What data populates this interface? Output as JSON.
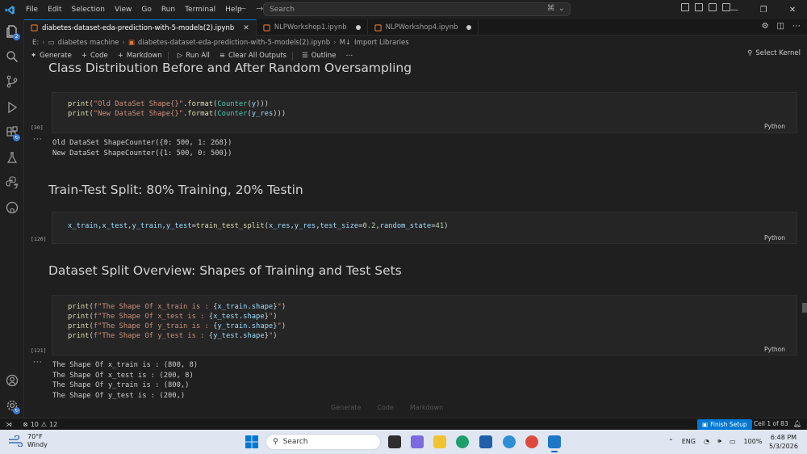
{
  "window": {
    "menu": [
      "File",
      "Edit",
      "Selection",
      "View",
      "Go",
      "Run",
      "Terminal",
      "Help"
    ],
    "search_placeholder": "Search"
  },
  "tabs": [
    {
      "label": "diabetes-dataset-eda-prediction-with-5-models(2).ipynb",
      "active": true,
      "modified": false
    },
    {
      "label": "NLPWorkshop1.ipynb",
      "active": false,
      "modified": true
    },
    {
      "label": "NLPWorkshop4.ipynb",
      "active": false,
      "modified": true
    }
  ],
  "breadcrumb": {
    "root": "E:",
    "folder": "diabetes machine",
    "file": "diabetes-dataset-eda-prediction-with-5-models(2).ipynb",
    "section_prefix": "M↓",
    "section": "Import Libraries"
  },
  "toolbar": {
    "generate": "Generate",
    "code": "Code",
    "markdown": "Markdown",
    "run_all": "Run All",
    "clear_outputs": "Clear All Outputs",
    "outline": "Outline",
    "select_kernel": "Select Kernel"
  },
  "headings": {
    "h1": "Class Distribution Before and After Random Oversampling",
    "h2": "Train-Test Split: 80% Training, 20% Testin",
    "h3": "Dataset Split Overview: Shapes of Training and Test Sets"
  },
  "cells": {
    "c1": {
      "count": "[30]",
      "lang": "Python",
      "code": [
        "print(\"Old DataSet Shape{}\".format(Counter(y)))",
        "print(\"New DataSet Shape{}\".format(Counter(y_res)))"
      ],
      "output": [
        "Old DataSet ShapeCounter({0: 500, 1: 268})",
        "New DataSet ShapeCounter({1: 500, 0: 500})"
      ]
    },
    "c2": {
      "count": "[120]",
      "lang": "Python",
      "code": [
        "x_train,x_test,y_train,y_test=train_test_split(x_res,y_res,test_size=0.2,random_state=41)"
      ]
    },
    "c3": {
      "count": "[121]",
      "lang": "Python",
      "code": [
        "print(f\"The Shape Of x_train is : {x_train.shape}\")",
        "print(f\"The Shape Of x_test is : {x_test.shape}\")",
        "print(f\"The Shape Of y_train is : {y_train.shape}\")",
        "print(f\"The Shape Of y_test is : {y_test.shape}\")"
      ],
      "output": [
        "The Shape Of x_train is : (800, 8)",
        "The Shape Of x_test is : (200, 8)",
        "The Shape Of y_train is : (800,)",
        "The Shape Of y_test is : (200,)"
      ]
    }
  },
  "ghost_toolbar": [
    "Generate",
    "Code",
    "Markdown"
  ],
  "statusbar": {
    "errors": "10",
    "warnings": "12",
    "finish_setup": "Finish Setup",
    "cell_position": "Cell 1 of 83"
  },
  "taskbar": {
    "temperature": "70°F",
    "weather": "Windy",
    "search": "Search",
    "language": "ENG",
    "battery": "100%",
    "time": "6:48 PM",
    "date": "5/3/2026"
  }
}
